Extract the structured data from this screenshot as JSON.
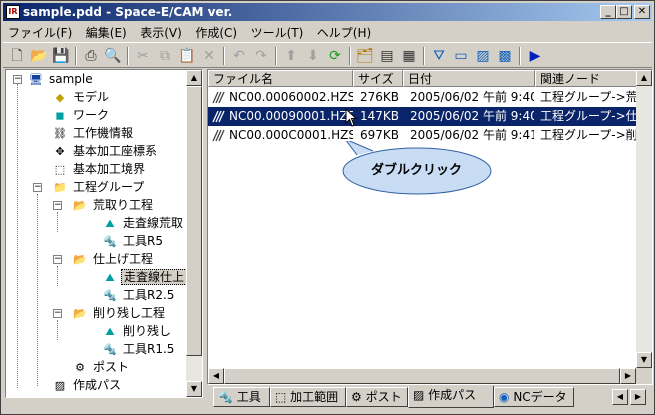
{
  "window": {
    "title": "sample.pdd - Space-E/CAM ver.",
    "minimize": "_",
    "maximize": "□",
    "close": "✕"
  },
  "menu": [
    "ファイル(F)",
    "編集(E)",
    "表示(V)",
    "作成(C)",
    "ツール(T)",
    "ヘルプ(H)"
  ],
  "tree": {
    "root": "sample",
    "items": [
      {
        "label": "モデル",
        "icon": "model-icon"
      },
      {
        "label": "ワーク",
        "icon": "work-icon"
      },
      {
        "label": "工作機情報",
        "icon": "machine-icon"
      },
      {
        "label": "基本加工座標系",
        "icon": "coordinate-icon"
      },
      {
        "label": "基本加工境界",
        "icon": "boundary-icon"
      },
      {
        "label": "工程グループ",
        "icon": "folder-icon"
      },
      {
        "label": "荒取り工程",
        "icon": "process-icon"
      },
      {
        "label": "走査線荒取",
        "icon": "path-icon"
      },
      {
        "label": "工具R5",
        "icon": "tool-icon"
      },
      {
        "label": "仕上げ工程",
        "icon": "process-icon"
      },
      {
        "label": "走査線仕上",
        "icon": "path-icon"
      },
      {
        "label": "工具R2.5",
        "icon": "tool-icon"
      },
      {
        "label": "削り残し工程",
        "icon": "process-icon"
      },
      {
        "label": "削り残し",
        "icon": "path-icon"
      },
      {
        "label": "工具R1.5",
        "icon": "tool-icon"
      },
      {
        "label": "ポスト",
        "icon": "post-icon"
      },
      {
        "label": "作成パス",
        "icon": "created-path-icon"
      }
    ]
  },
  "file_list": {
    "columns": [
      "ファイル名",
      "サイズ",
      "日付",
      "関連ノード"
    ],
    "rows": [
      {
        "name": "NC00.00060002.HZS",
        "size": "276KB",
        "date": "2005/06/02 午前 9:40",
        "node": "工程グループ->荒取り"
      },
      {
        "name": "NC00.00090001.HZS",
        "size": "147KB",
        "date": "2005/06/02 午前 9:40",
        "node": "工程グループ->仕上げ"
      },
      {
        "name": "NC00.000C0001.HZS",
        "size": "697KB",
        "date": "2005/06/02 午前 9:41",
        "node": "工程グループ->削り残"
      }
    ]
  },
  "callout": "ダブルクリック",
  "tabs": [
    "工具",
    "加工範囲",
    "ポスト",
    "作成パス",
    "NCデータ"
  ],
  "colors": {
    "title_start": "#0a246a",
    "title_end": "#a6caf0",
    "selection": "#0a246a",
    "callout_fill": "#c8dcf4"
  }
}
